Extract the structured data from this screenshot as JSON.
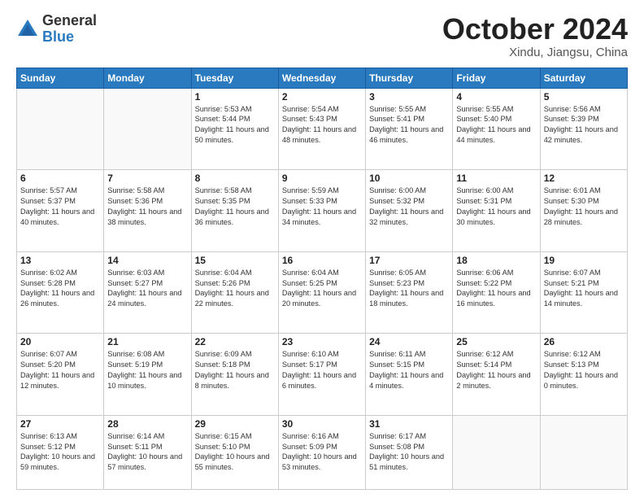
{
  "logo": {
    "general": "General",
    "blue": "Blue"
  },
  "header": {
    "month": "October 2024",
    "location": "Xindu, Jiangsu, China"
  },
  "weekdays": [
    "Sunday",
    "Monday",
    "Tuesday",
    "Wednesday",
    "Thursday",
    "Friday",
    "Saturday"
  ],
  "weeks": [
    [
      {
        "day": "",
        "info": ""
      },
      {
        "day": "",
        "info": ""
      },
      {
        "day": "1",
        "info": "Sunrise: 5:53 AM\nSunset: 5:44 PM\nDaylight: 11 hours and 50 minutes."
      },
      {
        "day": "2",
        "info": "Sunrise: 5:54 AM\nSunset: 5:43 PM\nDaylight: 11 hours and 48 minutes."
      },
      {
        "day": "3",
        "info": "Sunrise: 5:55 AM\nSunset: 5:41 PM\nDaylight: 11 hours and 46 minutes."
      },
      {
        "day": "4",
        "info": "Sunrise: 5:55 AM\nSunset: 5:40 PM\nDaylight: 11 hours and 44 minutes."
      },
      {
        "day": "5",
        "info": "Sunrise: 5:56 AM\nSunset: 5:39 PM\nDaylight: 11 hours and 42 minutes."
      }
    ],
    [
      {
        "day": "6",
        "info": "Sunrise: 5:57 AM\nSunset: 5:37 PM\nDaylight: 11 hours and 40 minutes."
      },
      {
        "day": "7",
        "info": "Sunrise: 5:58 AM\nSunset: 5:36 PM\nDaylight: 11 hours and 38 minutes."
      },
      {
        "day": "8",
        "info": "Sunrise: 5:58 AM\nSunset: 5:35 PM\nDaylight: 11 hours and 36 minutes."
      },
      {
        "day": "9",
        "info": "Sunrise: 5:59 AM\nSunset: 5:33 PM\nDaylight: 11 hours and 34 minutes."
      },
      {
        "day": "10",
        "info": "Sunrise: 6:00 AM\nSunset: 5:32 PM\nDaylight: 11 hours and 32 minutes."
      },
      {
        "day": "11",
        "info": "Sunrise: 6:00 AM\nSunset: 5:31 PM\nDaylight: 11 hours and 30 minutes."
      },
      {
        "day": "12",
        "info": "Sunrise: 6:01 AM\nSunset: 5:30 PM\nDaylight: 11 hours and 28 minutes."
      }
    ],
    [
      {
        "day": "13",
        "info": "Sunrise: 6:02 AM\nSunset: 5:28 PM\nDaylight: 11 hours and 26 minutes."
      },
      {
        "day": "14",
        "info": "Sunrise: 6:03 AM\nSunset: 5:27 PM\nDaylight: 11 hours and 24 minutes."
      },
      {
        "day": "15",
        "info": "Sunrise: 6:04 AM\nSunset: 5:26 PM\nDaylight: 11 hours and 22 minutes."
      },
      {
        "day": "16",
        "info": "Sunrise: 6:04 AM\nSunset: 5:25 PM\nDaylight: 11 hours and 20 minutes."
      },
      {
        "day": "17",
        "info": "Sunrise: 6:05 AM\nSunset: 5:23 PM\nDaylight: 11 hours and 18 minutes."
      },
      {
        "day": "18",
        "info": "Sunrise: 6:06 AM\nSunset: 5:22 PM\nDaylight: 11 hours and 16 minutes."
      },
      {
        "day": "19",
        "info": "Sunrise: 6:07 AM\nSunset: 5:21 PM\nDaylight: 11 hours and 14 minutes."
      }
    ],
    [
      {
        "day": "20",
        "info": "Sunrise: 6:07 AM\nSunset: 5:20 PM\nDaylight: 11 hours and 12 minutes."
      },
      {
        "day": "21",
        "info": "Sunrise: 6:08 AM\nSunset: 5:19 PM\nDaylight: 11 hours and 10 minutes."
      },
      {
        "day": "22",
        "info": "Sunrise: 6:09 AM\nSunset: 5:18 PM\nDaylight: 11 hours and 8 minutes."
      },
      {
        "day": "23",
        "info": "Sunrise: 6:10 AM\nSunset: 5:17 PM\nDaylight: 11 hours and 6 minutes."
      },
      {
        "day": "24",
        "info": "Sunrise: 6:11 AM\nSunset: 5:15 PM\nDaylight: 11 hours and 4 minutes."
      },
      {
        "day": "25",
        "info": "Sunrise: 6:12 AM\nSunset: 5:14 PM\nDaylight: 11 hours and 2 minutes."
      },
      {
        "day": "26",
        "info": "Sunrise: 6:12 AM\nSunset: 5:13 PM\nDaylight: 11 hours and 0 minutes."
      }
    ],
    [
      {
        "day": "27",
        "info": "Sunrise: 6:13 AM\nSunset: 5:12 PM\nDaylight: 10 hours and 59 minutes."
      },
      {
        "day": "28",
        "info": "Sunrise: 6:14 AM\nSunset: 5:11 PM\nDaylight: 10 hours and 57 minutes."
      },
      {
        "day": "29",
        "info": "Sunrise: 6:15 AM\nSunset: 5:10 PM\nDaylight: 10 hours and 55 minutes."
      },
      {
        "day": "30",
        "info": "Sunrise: 6:16 AM\nSunset: 5:09 PM\nDaylight: 10 hours and 53 minutes."
      },
      {
        "day": "31",
        "info": "Sunrise: 6:17 AM\nSunset: 5:08 PM\nDaylight: 10 hours and 51 minutes."
      },
      {
        "day": "",
        "info": ""
      },
      {
        "day": "",
        "info": ""
      }
    ]
  ]
}
